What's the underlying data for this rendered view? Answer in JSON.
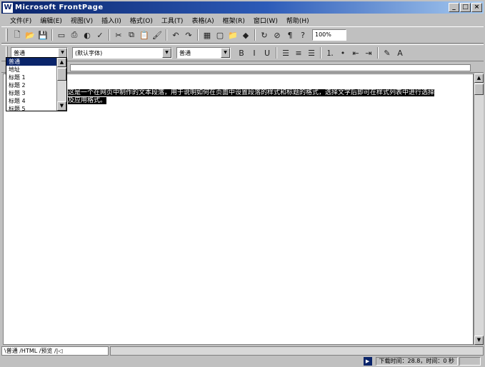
{
  "window": {
    "app_icon_glyph": "W",
    "title": "Microsoft FrontPage",
    "minimize_glyph": "_",
    "maximize_glyph": "□",
    "close_glyph": "×"
  },
  "menu": {
    "items": [
      "文件(F)",
      "编辑(E)",
      "视图(V)",
      "插入(I)",
      "格式(O)",
      "工具(T)",
      "表格(A)",
      "框架(R)",
      "窗口(W)",
      "帮助(H)"
    ]
  },
  "toolbar": {
    "buttons": [
      {
        "name": "new-icon",
        "glyph": "🗋"
      },
      {
        "name": "open-icon",
        "glyph": "📂"
      },
      {
        "name": "save-icon",
        "glyph": "💾"
      },
      {
        "name": "sep",
        "glyph": ""
      },
      {
        "name": "publish-icon",
        "glyph": "▭"
      },
      {
        "name": "print-icon",
        "glyph": "⎙"
      },
      {
        "name": "preview-icon",
        "glyph": "◐"
      },
      {
        "name": "spell-icon",
        "glyph": "✓"
      },
      {
        "name": "sep",
        "glyph": ""
      },
      {
        "name": "cut-icon",
        "glyph": "✂"
      },
      {
        "name": "copy-icon",
        "glyph": "⧉"
      },
      {
        "name": "paste-icon",
        "glyph": "📋"
      },
      {
        "name": "format-painter-icon",
        "glyph": "🖌"
      },
      {
        "name": "sep",
        "glyph": ""
      },
      {
        "name": "undo-icon",
        "glyph": "↶"
      },
      {
        "name": "redo-icon",
        "glyph": "↷"
      },
      {
        "name": "sep",
        "glyph": ""
      },
      {
        "name": "table-icon",
        "glyph": "▦"
      },
      {
        "name": "frame-icon",
        "glyph": "▢"
      },
      {
        "name": "folder-icon",
        "glyph": "📁"
      },
      {
        "name": "image-icon",
        "glyph": "◆"
      },
      {
        "name": "sep",
        "glyph": ""
      },
      {
        "name": "refresh-icon",
        "glyph": "↻"
      },
      {
        "name": "stop-icon",
        "glyph": "⊘"
      },
      {
        "name": "paragraph-icon",
        "glyph": "¶"
      },
      {
        "name": "help-icon",
        "glyph": "?"
      }
    ],
    "zoom_value": "100%"
  },
  "format_bar": {
    "style_value": "普通",
    "font_value": "(默认字体)",
    "size_value": "普通",
    "buttons": [
      {
        "name": "bold-icon",
        "glyph": "B"
      },
      {
        "name": "italic-icon",
        "glyph": "I"
      },
      {
        "name": "underline-icon",
        "glyph": "U"
      },
      {
        "name": "sep",
        "glyph": ""
      },
      {
        "name": "align-left-icon",
        "glyph": "☰"
      },
      {
        "name": "align-center-icon",
        "glyph": "≡"
      },
      {
        "name": "align-right-icon",
        "glyph": "☰"
      },
      {
        "name": "sep",
        "glyph": ""
      },
      {
        "name": "numbered-list-icon",
        "glyph": "⒈"
      },
      {
        "name": "bullet-list-icon",
        "glyph": "•"
      },
      {
        "name": "outdent-icon",
        "glyph": "⇤"
      },
      {
        "name": "indent-icon",
        "glyph": "⇥"
      },
      {
        "name": "sep",
        "glyph": ""
      },
      {
        "name": "highlight-icon",
        "glyph": "✎"
      },
      {
        "name": "font-color-icon",
        "glyph": "A"
      }
    ]
  },
  "style_dropdown": {
    "items": [
      "普通",
      "地址",
      "标题 1",
      "标题 2",
      "标题 3",
      "标题 4",
      "标题 5"
    ],
    "selected_index": 0
  },
  "document": {
    "line1": "这是一个在网页中制作的文本段落，用于说明如何在页面中设置段落的样式和标题的格式，选择文字后即可在样式列表中进行选择",
    "line2": "及应用格式。"
  },
  "tabs": {
    "text": "\\普通 /HTML /预览 /|◁"
  },
  "status": {
    "icon_glyph": "▶",
    "text": "下载时间：28.8，时间：0 秒"
  }
}
